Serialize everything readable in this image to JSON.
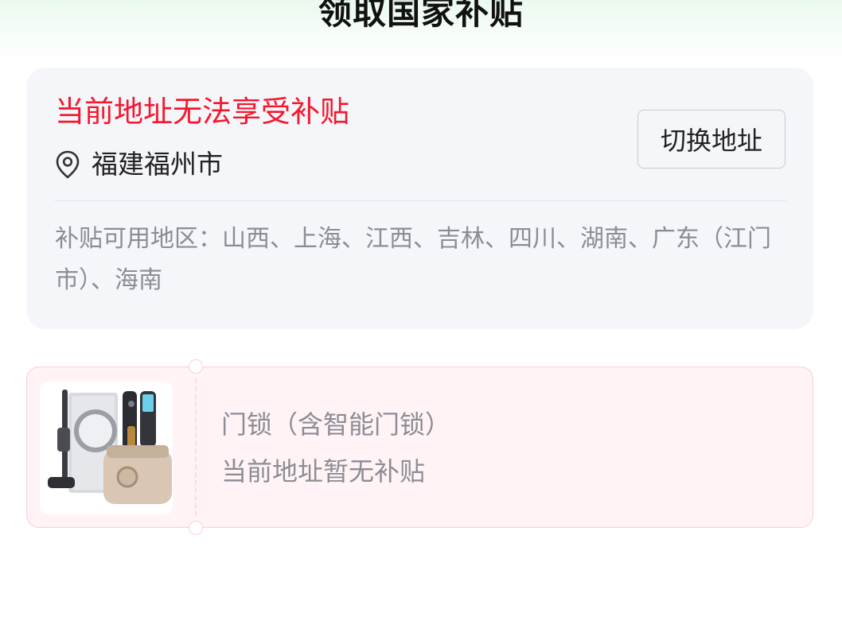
{
  "header": {
    "title": "领取国家补贴"
  },
  "address_card": {
    "status_title": "当前地址无法享受补贴",
    "location_icon": "location-pin-icon",
    "location": "福建福州市",
    "switch_button_label": "切换地址",
    "regions_text": "补贴可用地区：山西、上海、江西、吉林、四川、湖南、广东（江门市）、海南"
  },
  "product_card": {
    "image_icon": "smart-home-products-image",
    "name": "门锁（含智能门锁）",
    "status": "当前地址暂无补贴"
  },
  "colors": {
    "accent_red": "#f5172d",
    "muted_text": "#8b8d94",
    "card_bg": "#f5f6fa",
    "product_card_bg": "#fff3f6"
  }
}
